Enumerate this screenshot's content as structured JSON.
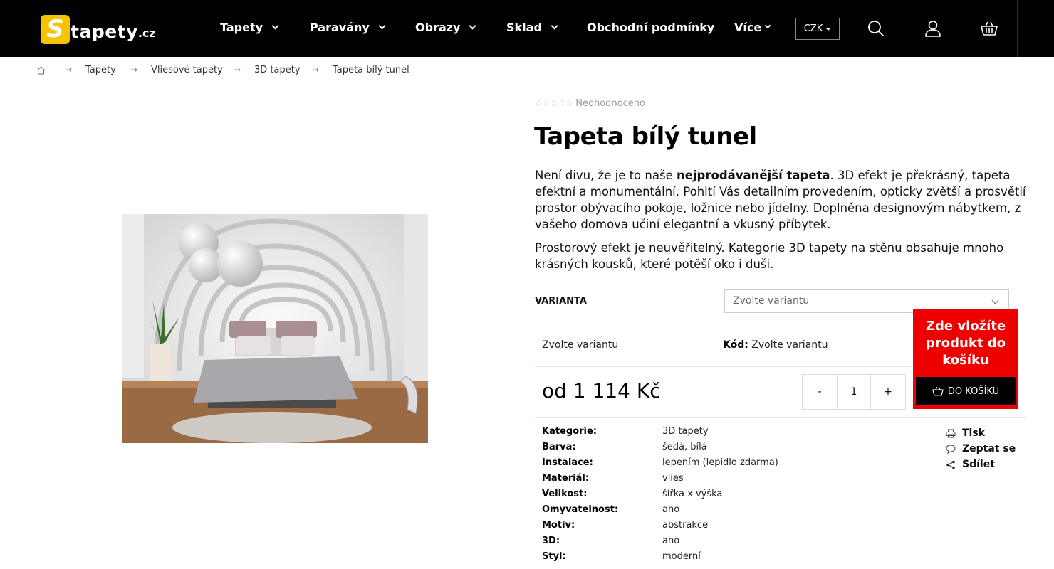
{
  "brand": {
    "logo_letter": "S",
    "logo_text": "tapety",
    "logo_tld": ".cz"
  },
  "nav": {
    "items": [
      {
        "label": "Tapety",
        "dropdown": true
      },
      {
        "label": "Paravány",
        "dropdown": true
      },
      {
        "label": "Obrazy",
        "dropdown": true
      },
      {
        "label": "Sklad",
        "dropdown": true
      },
      {
        "label": "Obchodní podmínky",
        "dropdown": false
      },
      {
        "label": "Více",
        "dropdown": true
      }
    ],
    "currency": "CZK"
  },
  "breadcrumb": [
    "Tapety",
    "Vliesové tapety",
    "3D tapety",
    "Tapeta bílý tunel"
  ],
  "product": {
    "rating_text": "Neohodnoceno",
    "title": "Tapeta bílý tunel",
    "desc1_a": "Není divu, že je to naše ",
    "desc1_b": "nejprodávanější tapeta",
    "desc1_c": ". 3D efekt je překrásný, tapeta efektní a monumentální. Pohltí Vás detailním provedením, opticky zvětší a prosvětlí prostor obývacího pokoje, ložnice nebo jídelny. Doplněna designovým nábytkem, z vašeho domova učiní elegantní a vkusný příbytek.",
    "desc2": "Prostorový efekt je neuvěřitelný. Kategorie 3D tapety na stěnu obsahuje mnoho krásných kousků, které potěší oko i duši.",
    "variant_label": "VARIANTA",
    "variant_placeholder": "Zvolte variantu",
    "variant_selected": "Zvolte variantu",
    "code_label": "Kód:",
    "code_value": "Zvolte variantu",
    "price": "od 1 114 Kč",
    "qty_minus": "-",
    "qty_value": "1",
    "qty_plus": "+",
    "promo_text": "Zde vložíte produkt do košíku",
    "cart_button": "DO KOŠÍKU"
  },
  "params": [
    {
      "name": "Kategorie:",
      "value": "3D tapety"
    },
    {
      "name": "Barva:",
      "value": "šedá, bílá"
    },
    {
      "name": "Instalace:",
      "value": "lepením (lepidlo zdarma)"
    },
    {
      "name": "Materiál:",
      "value": "vlies"
    },
    {
      "name": "Velikost:",
      "value": "šířka x výška"
    },
    {
      "name": "Omyvatelnost:",
      "value": "ano"
    },
    {
      "name": "Motiv:",
      "value": "abstrakce"
    },
    {
      "name": "3D:",
      "value": "ano"
    },
    {
      "name": "Styl:",
      "value": "moderní"
    }
  ],
  "actions": [
    "Tisk",
    "Zeptat se",
    "Sdílet"
  ],
  "colors": {
    "header_bg": "#000000",
    "accent_red": "#ee0000",
    "logo_yellow": "#f5c400"
  }
}
